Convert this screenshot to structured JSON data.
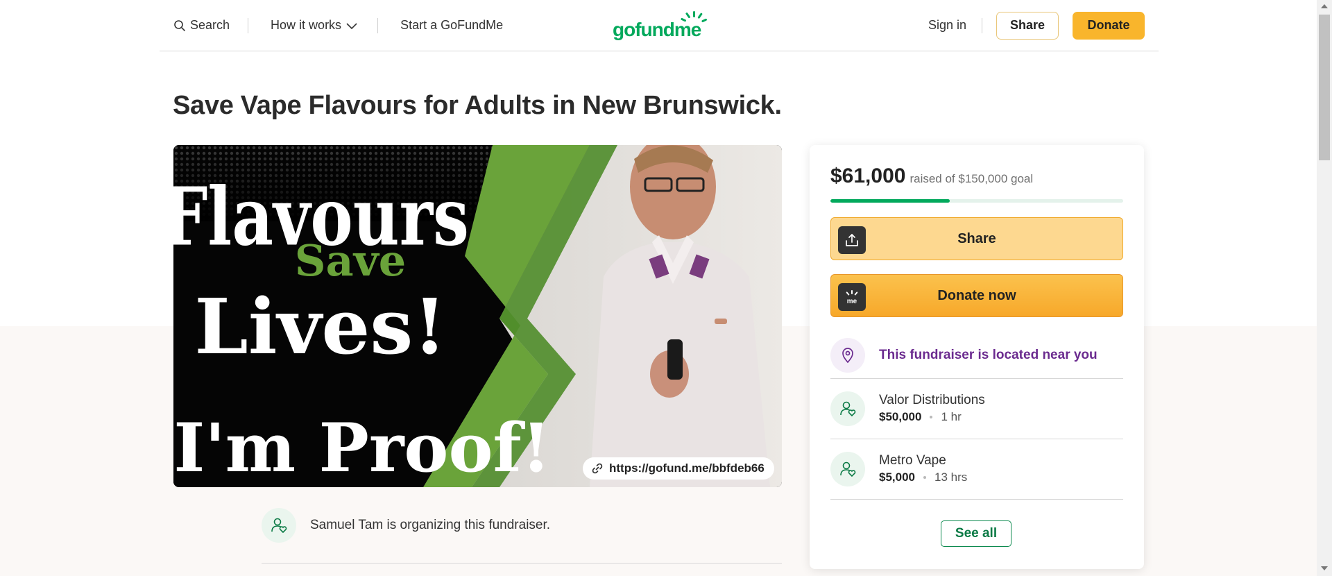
{
  "header": {
    "search_label": "Search",
    "how_it_works_label": "How it works",
    "start_label": "Start a GoFundMe",
    "logo_text": "gofundme",
    "signin_label": "Sign in",
    "share_label": "Share",
    "donate_label": "Donate"
  },
  "campaign": {
    "title": "Save Vape Flavours for Adults in New Brunswick.",
    "image": {
      "headline_top": "Flavours",
      "headline_accent": "Save",
      "headline_mid": "Lives!",
      "headline_bottom": "...I'm Proof!"
    },
    "short_url": "https://gofund.me/bbfdeb66",
    "organizer_text": "Samuel Tam is organizing this fundraiser."
  },
  "donation_card": {
    "raised_amount": "$61,000",
    "raised_of_goal": "raised of $150,000 goal",
    "progress_fraction": 0.4067,
    "share_label": "Share",
    "donate_now_label": "Donate now",
    "near_you_text": "This fundraiser is located near you",
    "donations": [
      {
        "name": "Valor Distributions",
        "amount": "$50,000",
        "time": "1 hr"
      },
      {
        "name": "Metro Vape",
        "amount": "$5,000",
        "time": "13 hrs"
      }
    ],
    "see_all_label": "See all"
  },
  "colors": {
    "brand_green": "#02a95c",
    "donate_yellow": "#f9b52c",
    "near_purple": "#6b2b8f"
  }
}
